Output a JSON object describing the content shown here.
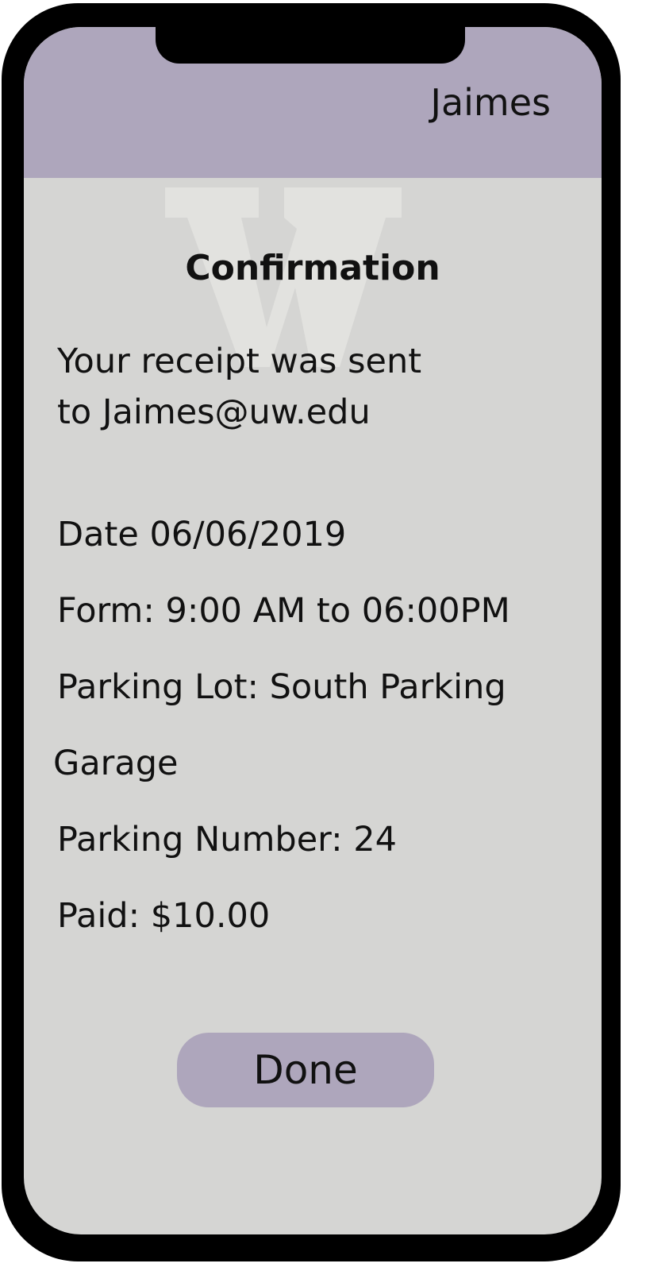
{
  "header": {
    "user_name": "Jaimes"
  },
  "logo": {
    "icon": "uw-w-logo-watermark"
  },
  "confirmation": {
    "title": "Confirmation",
    "receipt_line1": "Your receipt was sent",
    "receipt_line2": "to Jaimes@uw.edu",
    "date": "Date 06/06/2019",
    "time_range": "Form: 9:00 AM to 06:00PM",
    "parking_lot": "Parking Lot: South Parking",
    "parking_lot_cont": "Garage",
    "parking_number": "Parking Number: 24",
    "paid": "Paid: $10.00"
  },
  "actions": {
    "done_label": "Done"
  },
  "colors": {
    "header": "#aea6bc",
    "screen": "#d5d5d3",
    "frame": "#000000",
    "button": "#aea6bc"
  }
}
